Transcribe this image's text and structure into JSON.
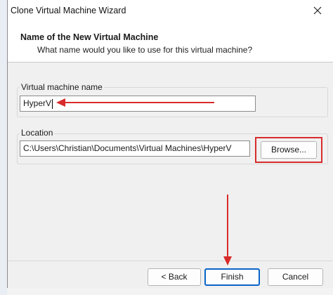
{
  "window": {
    "title": "Clone Virtual Machine Wizard"
  },
  "header": {
    "title": "Name of the New Virtual Machine",
    "subtitle": "What name would you like to use for this virtual machine?"
  },
  "vm_name": {
    "label": "Virtual machine name",
    "value": "HyperV"
  },
  "location": {
    "label": "Location",
    "value": "C:\\Users\\Christian\\Documents\\Virtual Machines\\HyperV",
    "browse_label": "Browse..."
  },
  "footer": {
    "back_label": "< Back",
    "finish_label": "Finish",
    "cancel_label": "Cancel"
  },
  "annotation_color": "#d92b2b",
  "icons": [
    "close-icon"
  ]
}
